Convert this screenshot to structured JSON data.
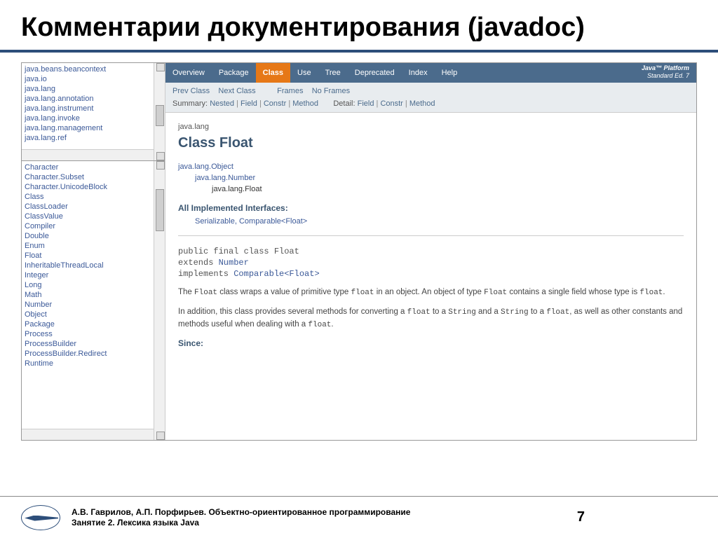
{
  "slide": {
    "title": "Комментарии документирования (javadoc)",
    "number": "7"
  },
  "footer": {
    "authors": "А.В. Гаврилов, А.П. Порфирьев. Объектно-ориентированное программирование",
    "lesson": "Занятие 2. Лексика языка Java"
  },
  "left": {
    "packages": [
      "java.beans.beancontext",
      "java.io",
      "java.lang",
      "java.lang.annotation",
      "java.lang.instrument",
      "java.lang.invoke",
      "java.lang.management",
      "java.lang.ref"
    ],
    "classes": [
      "Character",
      "Character.Subset",
      "Character.UnicodeBlock",
      "Class",
      "ClassLoader",
      "ClassValue",
      "Compiler",
      "Double",
      "Enum",
      "Float",
      "InheritableThreadLocal",
      "Integer",
      "Long",
      "Math",
      "Number",
      "Object",
      "Package",
      "Process",
      "ProcessBuilder",
      "ProcessBuilder.Redirect",
      "Runtime"
    ]
  },
  "nav": {
    "tabs": [
      "Overview",
      "Package",
      "Class",
      "Use",
      "Tree",
      "Deprecated",
      "Index",
      "Help"
    ],
    "platform": "Java™ Platform",
    "edition": "Standard Ed. 7"
  },
  "subnav": {
    "prev": "Prev Class",
    "next": "Next Class",
    "frames": "Frames",
    "noframes": "No Frames",
    "summary_label": "Summary:",
    "summary": [
      "Nested",
      "Field",
      "Constr",
      "Method"
    ],
    "detail_label": "Detail:",
    "detail": [
      "Field",
      "Constr",
      "Method"
    ]
  },
  "doc": {
    "pkg": "java.lang",
    "title": "Class Float",
    "hier": {
      "l0": "java.lang.Object",
      "l1": "java.lang.Number",
      "l2": "java.lang.Float"
    },
    "impl_heading": "All Implemented Interfaces:",
    "impl_list": "Serializable, Comparable<Float>",
    "sig_l1": "public final class Float",
    "sig_l2a": "extends ",
    "sig_l2b": "Number",
    "sig_l3a": "implements ",
    "sig_l3b": "Comparable<Float>",
    "p1a": "The ",
    "p1b": "Float",
    "p1c": " class wraps a value of primitive type ",
    "p1d": "float",
    "p1e": " in an object. An object of type ",
    "p1f": "Float",
    "p1g": " contains a single field whose type is ",
    "p1h": "float",
    "p1i": ".",
    "p2a": "In addition, this class provides several methods for converting a ",
    "p2b": "float",
    "p2c": " to a ",
    "p2d": "String",
    "p2e": " and a ",
    "p2f": "String",
    "p2g": " to a ",
    "p2h": "float",
    "p2i": ", as well as other constants and methods useful when dealing with a ",
    "p2j": "float",
    "p2k": ".",
    "since": "Since:"
  }
}
